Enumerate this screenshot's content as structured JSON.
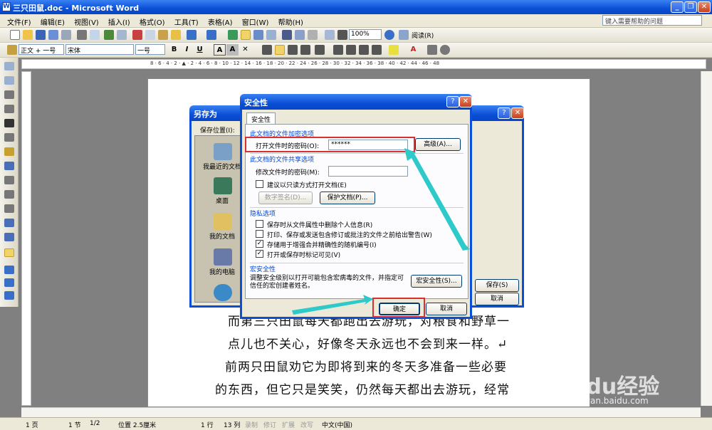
{
  "window": {
    "title": "三只田鼠.doc - Microsoft Word",
    "help_placeholder": "键入需要帮助的问题"
  },
  "menu": [
    "文件(F)",
    "编辑(E)",
    "视图(V)",
    "插入(I)",
    "格式(O)",
    "工具(T)",
    "表格(A)",
    "窗口(W)",
    "帮助(H)"
  ],
  "toolbar": {
    "zoom": "100%",
    "read": "阅读(R)",
    "style": "正文 + 一号",
    "font": "宋体",
    "size": "一号"
  },
  "document": {
    "lines": [
      "而第三只田鼠每天都跑出去游玩，对粮食和野草一",
      "点儿也不关心，好像冬天永远也不会到来一样。↵",
      "前两只田鼠劝它为即将到来的冬天多准备一些必要",
      "的东西，但它只是笑笑，仍然每天都出去游玩，经常"
    ]
  },
  "saveas": {
    "title": "另存为",
    "save_in": "保存位置(I):",
    "nav": [
      "我最近的文档",
      "桌面",
      "我的文档",
      "我的电脑"
    ],
    "save": "保存(S)",
    "cancel": "取消"
  },
  "security": {
    "title": "安全性",
    "tab": "安全性",
    "encrypt_section": "此文档的文件加密选项",
    "open_pwd_label": "打开文件时的密码(O):",
    "open_pwd_value": "******",
    "advanced": "高级(A)...",
    "share_section": "此文档的文件共享选项",
    "modify_pwd_label": "修改文件时的密码(M):",
    "readonly": "建议以只读方式打开文档(E)",
    "digital_sig": "数字签名(D)...",
    "protect_doc": "保护文档(P)...",
    "privacy_section": "隐私选项",
    "privacy_options": [
      {
        "label": "保存时从文件属性中删除个人信息(R)",
        "checked": false
      },
      {
        "label": "打印、保存或发送包含修订或批注的文件之前给出警告(W)",
        "checked": false
      },
      {
        "label": "存储用于增强合并精确性的随机编号(I)",
        "checked": true
      },
      {
        "label": "打开或保存时标记可见(V)",
        "checked": true
      }
    ],
    "macro_section": "宏安全性",
    "macro_text": "调整安全级别以打开可能包含宏病毒的文件，并指定可信任的宏创建者姓名。",
    "macro_btn": "宏安全性(S)...",
    "ok": "确定",
    "cancel": "取消"
  },
  "status": {
    "page": "1 页",
    "section": "1 节",
    "pages": "1/2",
    "pos": "位置 2.5厘米",
    "line": "1 行",
    "col": "13 列",
    "rec": "录制",
    "trk": "修订",
    "ext": "扩展",
    "ovr": "改写",
    "lang": "中文(中国)"
  },
  "watermark": {
    "brand": "Baidu经验",
    "url": "jingyan.baidu.com"
  },
  "colors": {
    "accent": "#0a4fd6",
    "highlight": "#d83030",
    "arrow": "#2ec9c9"
  }
}
